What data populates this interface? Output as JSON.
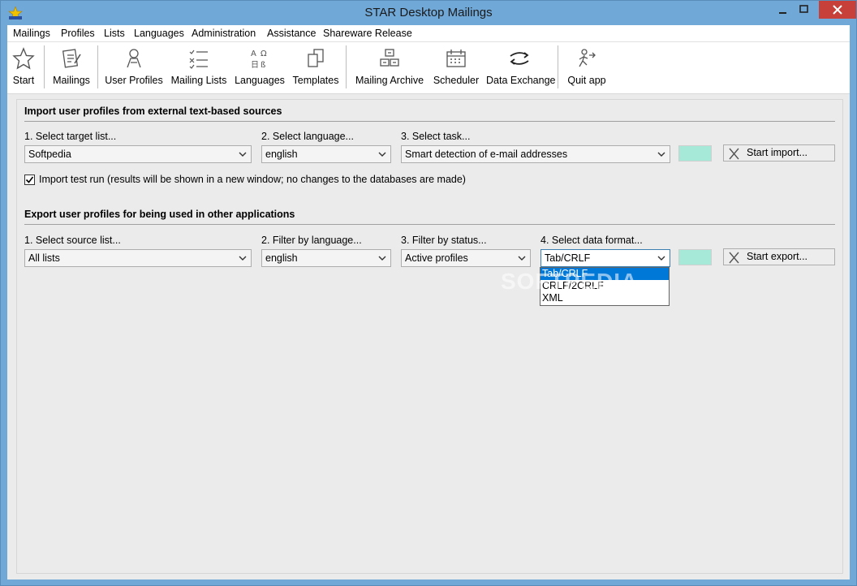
{
  "window": {
    "title": "STAR Desktop Mailings"
  },
  "menu": [
    "Mailings",
    "Profiles",
    "Lists",
    "Languages",
    "Administration",
    "Assistance",
    "Shareware Release"
  ],
  "toolbar": {
    "start": "Start",
    "mailings": "Mailings",
    "user_profiles": "User Profiles",
    "mailing_lists": "Mailing Lists",
    "languages": "Languages",
    "templates": "Templates",
    "mailing_archive": "Mailing Archive",
    "scheduler": "Scheduler",
    "data_exchange": "Data Exchange",
    "quit": "Quit app"
  },
  "import": {
    "title": "Import user profiles from external text-based sources",
    "target_label": "1. Select target list...",
    "target_value": "Softpedia",
    "language_label": "2. Select language...",
    "language_value": "english",
    "task_label": "3. Select task...",
    "task_value": "Smart detection of e-mail addresses",
    "button": "Start import...",
    "test_run_checked": true,
    "test_run_label": "Import test run (results will be shown in a new window; no changes to the databases are made)"
  },
  "export": {
    "title": "Export user profiles for being used in other applications",
    "source_label": "1. Select source list...",
    "source_value": "All lists",
    "language_label": "2. Filter by language...",
    "language_value": "english",
    "status_label": "3. Filter by status...",
    "status_value": "Active profiles",
    "format_label": "4. Select data format...",
    "format_value": "Tab/CRLF",
    "format_options": [
      "Tab/CRLF",
      "CRLF/2CRLF",
      "XML"
    ],
    "button": "Start export..."
  },
  "colors": {
    "indicator": "#a6e9d8",
    "selection": "#0078d7",
    "titlebar": "#70a8d8"
  },
  "watermark": "SOFTPEDIA"
}
